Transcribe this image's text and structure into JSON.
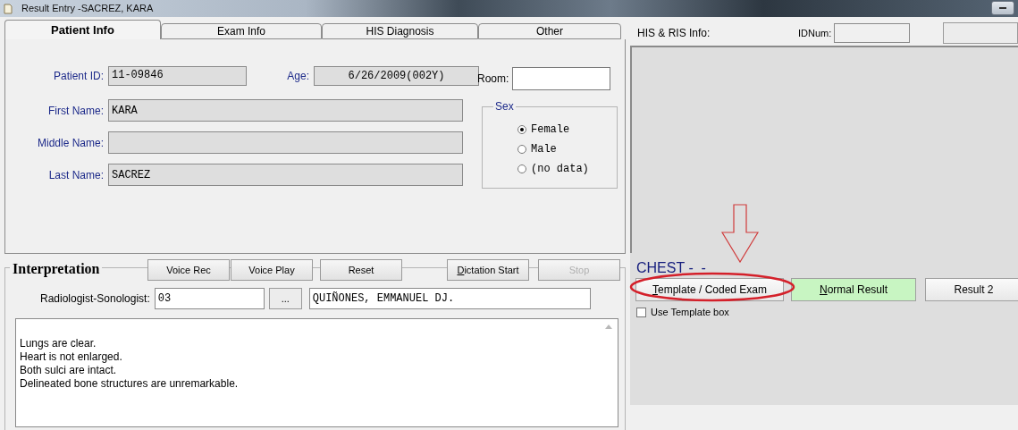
{
  "window": {
    "title": "Result Entry -SACREZ, KARA"
  },
  "tabs": [
    {
      "label": "Patient Info",
      "selected": true
    },
    {
      "label": "Exam Info",
      "selected": false
    },
    {
      "label": "HIS Diagnosis",
      "selected": false
    },
    {
      "label": "Other",
      "selected": false
    }
  ],
  "patient": {
    "patient_id_label": "Patient ID:",
    "patient_id": "11-09846",
    "age_label": "Age:",
    "age": "6/26/2009(002Y)",
    "room_label": "Room:",
    "first_name_label": "First Name:",
    "first_name": "KARA",
    "middle_name_label": "Middle Name:",
    "last_name_label": "Last Name:",
    "last_name": "SACREZ",
    "sex": {
      "label": "Sex",
      "options": [
        {
          "label": "Female",
          "selected": true
        },
        {
          "label": "Male",
          "selected": false
        },
        {
          "label": "(no data)",
          "selected": false
        }
      ]
    }
  },
  "interpretation": {
    "title": "Interpretation",
    "buttons": [
      {
        "label": "Voice Rec",
        "disabled": false,
        "mnemonic": false
      },
      {
        "label": "Voice Play",
        "disabled": false,
        "mnemonic": false
      },
      {
        "label": "Reset",
        "disabled": false,
        "mnemonic": false
      },
      {
        "label": "Dictation Start",
        "disabled": false,
        "mnemonic": true
      },
      {
        "label": "Stop",
        "disabled": true,
        "mnemonic": false
      }
    ],
    "radiologist_label": "Radiologist-Sonologist:",
    "radiologist_code": "03",
    "browse_button": "...",
    "radiologist_name": "QUIÑONES, EMMANUEL DJ.",
    "text_lines": [
      "Lungs are clear.",
      "Heart is not enlarged.",
      "Both sulci are intact.",
      "Delineated bone structures are unremarkable."
    ]
  },
  "his_ris": {
    "label": "HIS & RIS Info:",
    "idnum_label": "IDNum:",
    "exam_title": "CHEST -  -",
    "buttons": [
      {
        "label": "Template / Coded Exam",
        "kind": "plain",
        "mnemonic": true
      },
      {
        "label": "Normal Result",
        "kind": "green",
        "mnemonic": true
      },
      {
        "label": "Result 2",
        "kind": "plain",
        "mnemonic": false
      }
    ],
    "use_template": {
      "label": "Use Template box",
      "checked": false
    }
  },
  "annotations": {
    "arrow": true,
    "highlight_ellipse": true
  }
}
